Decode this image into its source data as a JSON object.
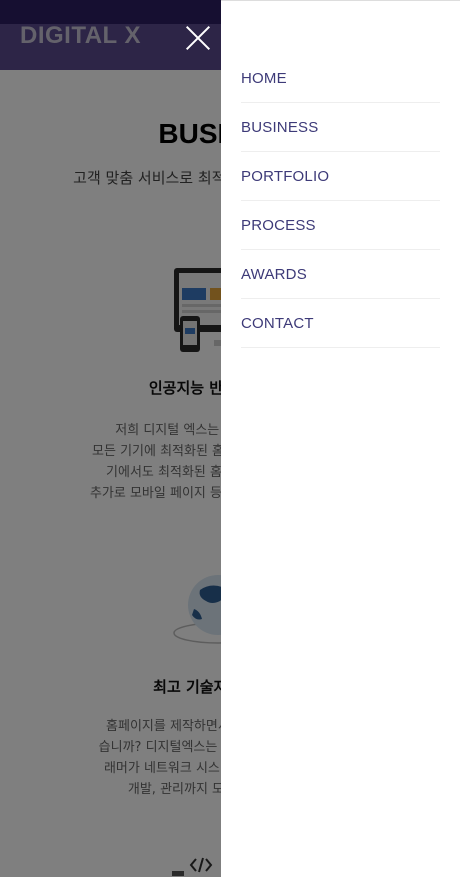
{
  "header": {
    "logo": "DIGITAL X"
  },
  "section": {
    "title": "BUSINESS",
    "subtitle": "고객 맞춤 서비스로 최적의 홈페이지를 제작합니다"
  },
  "cards": [
    {
      "title": "인공지능 반응형 홈페이지",
      "lines": [
        "저희 디지털 엑스는 PC, 모바일, 태블릿 등",
        "모든 기기에 최적화된 홈페이지를 제작합니다. 어떤",
        "기에서도 최적화된 홈페이지를 보실 수 있으며",
        "추가로 모바일 페이지 등을 제작할 필요가 없습니다."
      ]
    },
    {
      "title": "최고 기술자 최고 전문가",
      "lines": [
        "홈페이지를 제작하면서 어려운 점이 많지 않으",
        "습니까? 디지털엑스는 프로젝트 매니저와 프로그",
        "래머가 네트워크 시스템의 설계부터 분석, 개발",
        "개발, 관리까지 모든 것을 책임집니다."
      ]
    }
  ],
  "nav": {
    "close_label": "×",
    "items": [
      "HOME",
      "BUSINESS",
      "PORTFOLIO",
      "PROCESS",
      "AWARDS",
      "CONTACT"
    ]
  }
}
